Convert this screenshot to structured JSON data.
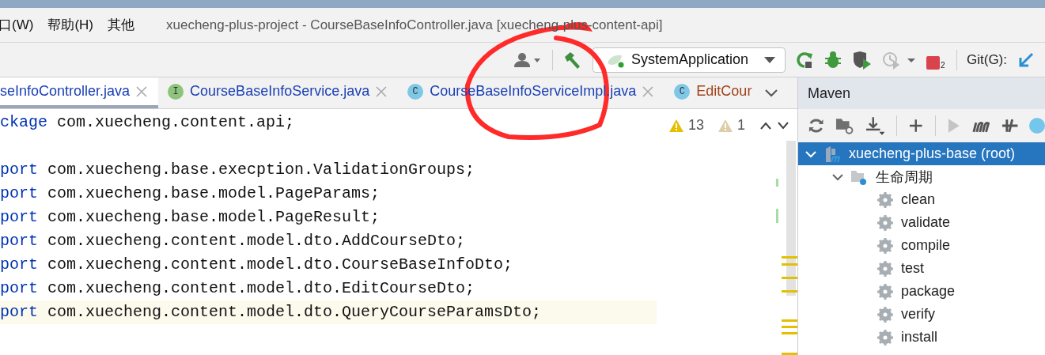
{
  "menu": [
    {
      "label": "口(W)"
    },
    {
      "label": "帮助(H)"
    },
    {
      "label": "其他"
    }
  ],
  "window": {
    "title": "xuecheng-plus-project - CourseBaseInfoController.java [xuecheng-plus-content-api]"
  },
  "toolbar": {
    "run_config": "SystemApplication",
    "stop_badge": "2",
    "git_label": "Git(G):"
  },
  "tabs": [
    {
      "label": "seInfoController.java",
      "selected": true,
      "color": "#1a3fb5"
    },
    {
      "label": "CourseBaseInfoService.java",
      "icon": {
        "letter": "I",
        "color": "#8dc37a"
      },
      "selected": false,
      "color": "#1a3fb5"
    },
    {
      "label": "CourseBaseInfoServiceImpl.java",
      "icon": {
        "letter": "C",
        "color": "#7fc7e6"
      },
      "selected": false,
      "color": "#1a3fb5"
    },
    {
      "label": "EditCour",
      "icon": {
        "letter": "C",
        "color": "#7fc7e6"
      },
      "selected": false,
      "color": "#a0421a"
    }
  ],
  "inspections": {
    "warnings": "13",
    "weak_warnings": "1"
  },
  "code": [
    {
      "kind": "code",
      "keyword": "ckage",
      "text": " com.xuecheng.content.api;",
      "current": false
    },
    {
      "kind": "blank"
    },
    {
      "kind": "code",
      "keyword": "port",
      "text": " com.xuecheng.base.execption.ValidationGroups;",
      "current": false
    },
    {
      "kind": "code",
      "keyword": "port",
      "text": " com.xuecheng.base.model.PageParams;",
      "current": false
    },
    {
      "kind": "code",
      "keyword": "port",
      "text": " com.xuecheng.base.model.PageResult;",
      "current": false
    },
    {
      "kind": "code",
      "keyword": "port",
      "text": " com.xuecheng.content.model.dto.AddCourseDto;",
      "current": false
    },
    {
      "kind": "code",
      "keyword": "port",
      "text": " com.xuecheng.content.model.dto.CourseBaseInfoDto;",
      "current": false
    },
    {
      "kind": "code",
      "keyword": "port",
      "text": " com.xuecheng.content.model.dto.EditCourseDto;",
      "current": false
    },
    {
      "kind": "code",
      "keyword": "port",
      "text": " com.xuecheng.content.model.dto.QueryCourseParamsDto;",
      "current": true
    }
  ],
  "maven": {
    "title": "Maven",
    "tree": [
      {
        "label": "xuecheng-plus-base (root)",
        "kind": "module",
        "selected": true,
        "expanded": true,
        "children": [
          {
            "label": "生命周期",
            "kind": "folder",
            "selected": false,
            "expanded": true,
            "children": [
              {
                "label": "clean",
                "kind": "goal",
                "selected": false
              },
              {
                "label": "validate",
                "kind": "goal",
                "selected": false
              },
              {
                "label": "compile",
                "kind": "goal",
                "selected": false
              },
              {
                "label": "test",
                "kind": "goal",
                "selected": false
              },
              {
                "label": "package",
                "kind": "goal",
                "selected": false
              },
              {
                "label": "verify",
                "kind": "goal",
                "selected": false
              },
              {
                "label": "install",
                "kind": "goal",
                "selected": false
              }
            ]
          }
        ]
      }
    ]
  }
}
